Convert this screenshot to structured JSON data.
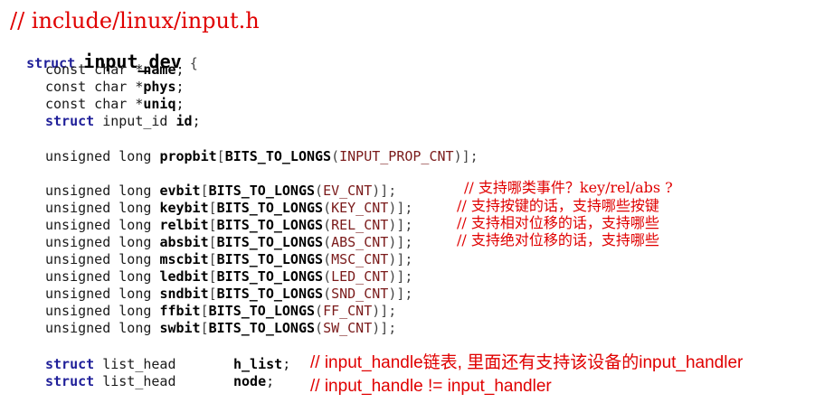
{
  "header": {
    "file_comment": "// include/linux/input.h"
  },
  "struct_decl": {
    "keyword": "struct",
    "name": "input_dev",
    "brace": "{"
  },
  "const_fields": [
    {
      "type": "const char *",
      "name": "name",
      "end": ";"
    },
    {
      "type": "const char *",
      "name": "phys",
      "end": ";"
    },
    {
      "type": "const char *",
      "name": "uniq",
      "end": ";"
    }
  ],
  "id_field": {
    "keyword": "struct",
    "type": "input_id",
    "name": "id",
    "end": ";"
  },
  "propbit": {
    "type": "unsigned long",
    "name": "propbit",
    "macro": "BITS_TO_LONGS",
    "arg": "INPUT_PROP_CNT"
  },
  "bit_fields": [
    {
      "type": "unsigned long",
      "name": "evbit",
      "macro": "BITS_TO_LONGS",
      "arg": "EV_CNT",
      "comment": "// 支持哪类事件？key/rel/abs ?"
    },
    {
      "type": "unsigned long",
      "name": "keybit",
      "macro": "BITS_TO_LONGS",
      "arg": "KEY_CNT",
      "comment": "// 支持按键的话，支持哪些按键"
    },
    {
      "type": "unsigned long",
      "name": "relbit",
      "macro": "BITS_TO_LONGS",
      "arg": "REL_CNT",
      "comment": "// 支持相对位移的话，支持哪些"
    },
    {
      "type": "unsigned long",
      "name": "absbit",
      "macro": "BITS_TO_LONGS",
      "arg": "ABS_CNT",
      "comment": "// 支持绝对位移的话，支持哪些"
    },
    {
      "type": "unsigned long",
      "name": "mscbit",
      "macro": "BITS_TO_LONGS",
      "arg": "MSC_CNT",
      "comment": ""
    },
    {
      "type": "unsigned long",
      "name": "ledbit",
      "macro": "BITS_TO_LONGS",
      "arg": "LED_CNT",
      "comment": ""
    },
    {
      "type": "unsigned long",
      "name": "sndbit",
      "macro": "BITS_TO_LONGS",
      "arg": "SND_CNT",
      "comment": ""
    },
    {
      "type": "unsigned long",
      "name": "ffbit",
      "macro": "BITS_TO_LONGS",
      "arg": "FF_CNT",
      "comment": ""
    },
    {
      "type": "unsigned long",
      "name": "swbit",
      "macro": "BITS_TO_LONGS",
      "arg": "SW_CNT",
      "comment": ""
    }
  ],
  "list_fields": [
    {
      "keyword": "struct",
      "type": "list_head",
      "name": "h_list",
      "end": ";",
      "comment": "// input_handle链表, 里面还有支持该设备的input_handler"
    },
    {
      "keyword": "struct",
      "type": "list_head",
      "name": "node",
      "end": ";",
      "comment": "// input_handle != input_handler"
    }
  ],
  "colors": {
    "comment": "#e00000",
    "keyword": "#1f1f99",
    "text": "#1a1a1a",
    "constant": "#7a1a1a"
  }
}
